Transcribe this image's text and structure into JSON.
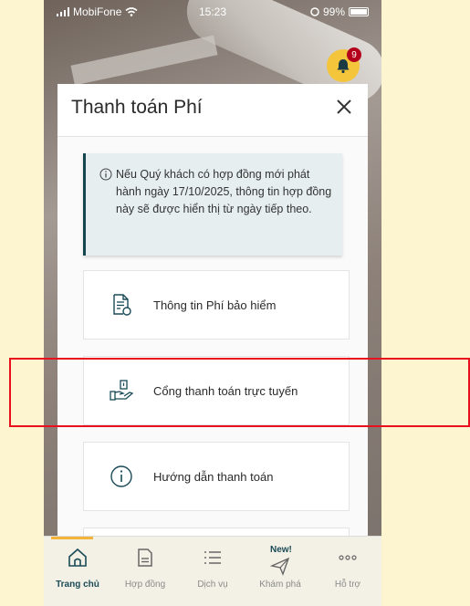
{
  "status_bar": {
    "carrier": "MobiFone",
    "time": "15:23",
    "battery": "99%"
  },
  "notifications": {
    "count": "9"
  },
  "modal": {
    "title": "Thanh toán Phí",
    "notice": "Nếu Quý khách có hợp đồng mới phát hành ngày 17/10/2025, thông tin hợp đồng này sẽ được hiển thị từ ngày tiếp theo.",
    "options": [
      {
        "label": "Thông tin Phí bảo hiểm",
        "icon": "document-icon"
      },
      {
        "label": "Cổng thanh toán trực tuyến",
        "icon": "hand-card-icon"
      },
      {
        "label": "Hướng dẫn thanh toán",
        "icon": "info-icon"
      }
    ]
  },
  "tabs": [
    {
      "label": "Trang chủ",
      "icon": "home-icon",
      "active": true
    },
    {
      "label": "Hợp đồng",
      "icon": "contract-icon"
    },
    {
      "label": "Dịch vụ",
      "icon": "list-icon"
    },
    {
      "label": "Khám phá",
      "icon": "paper-plane-icon",
      "badge": "New!"
    },
    {
      "label": "Hỗ trợ",
      "icon": "more-icon"
    }
  ],
  "colors": {
    "accent": "#f4b43b",
    "primary": "#14464f",
    "highlight": "#e8101c",
    "badge": "#b3001b"
  }
}
